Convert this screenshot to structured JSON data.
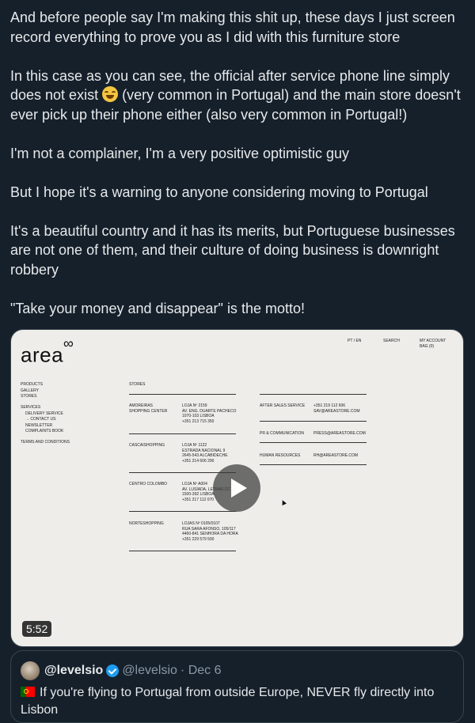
{
  "tweet": {
    "paragraphs": [
      "And before people say I'm making this shit up, these days I just screen record everything to prove you as I did with this furniture store",
      "In this case as you can see, the official after service phone line simply does not exist",
      "(very common in Portugal) and the main store doesn't ever pick up their phone either (also very common in Portugal!)",
      "I'm not a complainer, I'm a very positive optimistic guy",
      "But I hope it's a warning to anyone considering moving to Portugal",
      "It's a beautiful country and it has its merits, but Portuguese businesses are not one of them, and their culture of doing business is downright robbery",
      "\"Take your money and disappear\" is the motto!"
    ],
    "emoji_icon": "face-with-tears-of-joy-icon"
  },
  "video": {
    "duration": "5:52",
    "site": {
      "logo": "area",
      "logo_mark": "∞",
      "top_lang": "PT / EN",
      "top_search": "SEARCH",
      "top_account": "MY ACCOUNT",
      "top_bag": "BAG (0)",
      "nav": [
        "PRODUCTS",
        "GALLERY",
        "STORES"
      ],
      "nav_services": "SERVICES",
      "nav_services_sub": [
        "DELIVERY SERVICE",
        "→ CONTACT US",
        "NEWSLETTER",
        "COMPLAINTS BOOK"
      ],
      "nav_terms": "TERMS AND CONDITIONS",
      "stores_heading": "STORES",
      "stores": [
        {
          "name": "AMOREIRAS\nSHOPPING CENTER",
          "address": "LOJA Nº 2159\nAV. ENG. DUARTE PACHECO\n1070-103 LISBOA\n+351 213 715 350"
        },
        {
          "name": "CASCAISHOPPING",
          "address": "LOJA Nº 1122\nESTRADA NACIONAL 9\n2645-543 ALCABIDECHE\n+351 214 606 290"
        },
        {
          "name": "CENTRO COLOMBO",
          "address": "LOJA Nº A004\nAV. LUSÍADA, LETRAS CC\n1500-392 LISBOA\n+351 217 112 070"
        },
        {
          "name": "NORTESHOPPING",
          "address": "LOJAS Nº 0105/0107\nRUA SARA AFONSO, 105/117\n4460-841 SENHORA DA HORA\n+351 229 579 500"
        }
      ],
      "contacts": [
        {
          "label": "AFTER SALES SERVICE",
          "value": "+351 219 112 606\nSAV@AREASTORE.COM"
        },
        {
          "label": "PR & COMMUNICATION",
          "value": "PRESS@AREASTORE.COM"
        },
        {
          "label": "HUMAN RESOURCES",
          "value": "RH@AREASTORE.COM"
        }
      ]
    }
  },
  "quote": {
    "name": "@levelsio",
    "handle": "@levelsio",
    "date": "· Dec 6",
    "text": "If you're flying to Portugal from outside Europe, NEVER fly directly into Lisbon"
  }
}
